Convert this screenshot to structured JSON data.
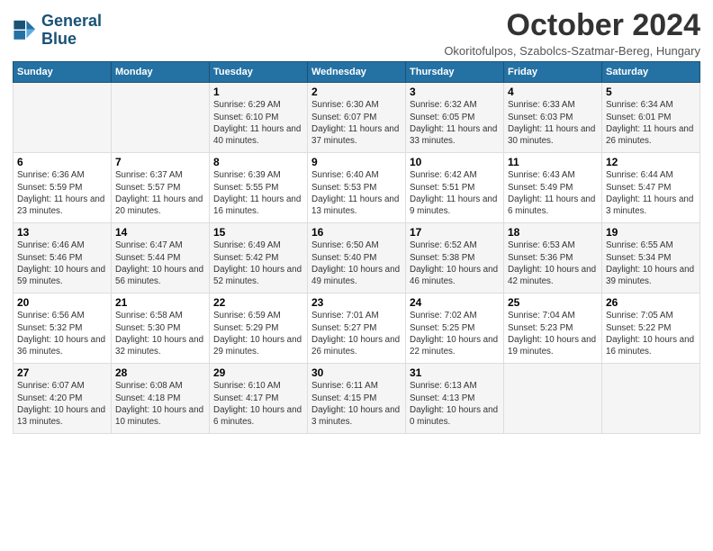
{
  "logo": {
    "line1": "General",
    "line2": "Blue"
  },
  "title": "October 2024",
  "subtitle": "Okoritofulpos, Szabolcs-Szatmar-Bereg, Hungary",
  "days_of_week": [
    "Sunday",
    "Monday",
    "Tuesday",
    "Wednesday",
    "Thursday",
    "Friday",
    "Saturday"
  ],
  "weeks": [
    [
      {
        "day": "",
        "info": ""
      },
      {
        "day": "",
        "info": ""
      },
      {
        "day": "1",
        "info": "Sunrise: 6:29 AM\nSunset: 6:10 PM\nDaylight: 11 hours\nand 40 minutes."
      },
      {
        "day": "2",
        "info": "Sunrise: 6:30 AM\nSunset: 6:07 PM\nDaylight: 11 hours\nand 37 minutes."
      },
      {
        "day": "3",
        "info": "Sunrise: 6:32 AM\nSunset: 6:05 PM\nDaylight: 11 hours\nand 33 minutes."
      },
      {
        "day": "4",
        "info": "Sunrise: 6:33 AM\nSunset: 6:03 PM\nDaylight: 11 hours\nand 30 minutes."
      },
      {
        "day": "5",
        "info": "Sunrise: 6:34 AM\nSunset: 6:01 PM\nDaylight: 11 hours\nand 26 minutes."
      }
    ],
    [
      {
        "day": "6",
        "info": "Sunrise: 6:36 AM\nSunset: 5:59 PM\nDaylight: 11 hours\nand 23 minutes."
      },
      {
        "day": "7",
        "info": "Sunrise: 6:37 AM\nSunset: 5:57 PM\nDaylight: 11 hours\nand 20 minutes."
      },
      {
        "day": "8",
        "info": "Sunrise: 6:39 AM\nSunset: 5:55 PM\nDaylight: 11 hours\nand 16 minutes."
      },
      {
        "day": "9",
        "info": "Sunrise: 6:40 AM\nSunset: 5:53 PM\nDaylight: 11 hours\nand 13 minutes."
      },
      {
        "day": "10",
        "info": "Sunrise: 6:42 AM\nSunset: 5:51 PM\nDaylight: 11 hours\nand 9 minutes."
      },
      {
        "day": "11",
        "info": "Sunrise: 6:43 AM\nSunset: 5:49 PM\nDaylight: 11 hours\nand 6 minutes."
      },
      {
        "day": "12",
        "info": "Sunrise: 6:44 AM\nSunset: 5:47 PM\nDaylight: 11 hours\nand 3 minutes."
      }
    ],
    [
      {
        "day": "13",
        "info": "Sunrise: 6:46 AM\nSunset: 5:46 PM\nDaylight: 10 hours\nand 59 minutes."
      },
      {
        "day": "14",
        "info": "Sunrise: 6:47 AM\nSunset: 5:44 PM\nDaylight: 10 hours\nand 56 minutes."
      },
      {
        "day": "15",
        "info": "Sunrise: 6:49 AM\nSunset: 5:42 PM\nDaylight: 10 hours\nand 52 minutes."
      },
      {
        "day": "16",
        "info": "Sunrise: 6:50 AM\nSunset: 5:40 PM\nDaylight: 10 hours\nand 49 minutes."
      },
      {
        "day": "17",
        "info": "Sunrise: 6:52 AM\nSunset: 5:38 PM\nDaylight: 10 hours\nand 46 minutes."
      },
      {
        "day": "18",
        "info": "Sunrise: 6:53 AM\nSunset: 5:36 PM\nDaylight: 10 hours\nand 42 minutes."
      },
      {
        "day": "19",
        "info": "Sunrise: 6:55 AM\nSunset: 5:34 PM\nDaylight: 10 hours\nand 39 minutes."
      }
    ],
    [
      {
        "day": "20",
        "info": "Sunrise: 6:56 AM\nSunset: 5:32 PM\nDaylight: 10 hours\nand 36 minutes."
      },
      {
        "day": "21",
        "info": "Sunrise: 6:58 AM\nSunset: 5:30 PM\nDaylight: 10 hours\nand 32 minutes."
      },
      {
        "day": "22",
        "info": "Sunrise: 6:59 AM\nSunset: 5:29 PM\nDaylight: 10 hours\nand 29 minutes."
      },
      {
        "day": "23",
        "info": "Sunrise: 7:01 AM\nSunset: 5:27 PM\nDaylight: 10 hours\nand 26 minutes."
      },
      {
        "day": "24",
        "info": "Sunrise: 7:02 AM\nSunset: 5:25 PM\nDaylight: 10 hours\nand 22 minutes."
      },
      {
        "day": "25",
        "info": "Sunrise: 7:04 AM\nSunset: 5:23 PM\nDaylight: 10 hours\nand 19 minutes."
      },
      {
        "day": "26",
        "info": "Sunrise: 7:05 AM\nSunset: 5:22 PM\nDaylight: 10 hours\nand 16 minutes."
      }
    ],
    [
      {
        "day": "27",
        "info": "Sunrise: 6:07 AM\nSunset: 4:20 PM\nDaylight: 10 hours\nand 13 minutes."
      },
      {
        "day": "28",
        "info": "Sunrise: 6:08 AM\nSunset: 4:18 PM\nDaylight: 10 hours\nand 10 minutes."
      },
      {
        "day": "29",
        "info": "Sunrise: 6:10 AM\nSunset: 4:17 PM\nDaylight: 10 hours\nand 6 minutes."
      },
      {
        "day": "30",
        "info": "Sunrise: 6:11 AM\nSunset: 4:15 PM\nDaylight: 10 hours\nand 3 minutes."
      },
      {
        "day": "31",
        "info": "Sunrise: 6:13 AM\nSunset: 4:13 PM\nDaylight: 10 hours\nand 0 minutes."
      },
      {
        "day": "",
        "info": ""
      },
      {
        "day": "",
        "info": ""
      }
    ]
  ]
}
